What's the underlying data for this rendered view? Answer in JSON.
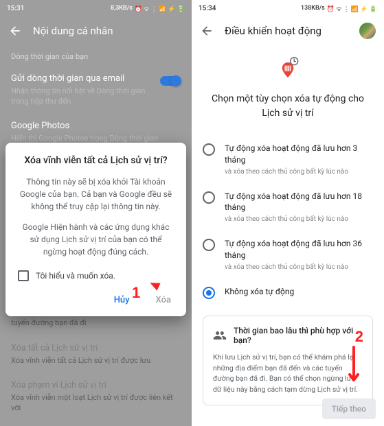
{
  "left": {
    "status": {
      "time": "15:31",
      "net": "8,3KB/s"
    },
    "header": {
      "title": "Nội dung cá nhân"
    },
    "timeline_label": "Dòng thời gian của bạn",
    "email": {
      "title": "Gửi dòng thời gian qua email",
      "sub": "Nhận thông tin nổi bật về Dòng thời gian trong hộp thư đến"
    },
    "photos": {
      "title": "Google Photos",
      "sub": "Hiển thị Google Photos trong Dòng thời gian"
    },
    "dialog": {
      "title": "Xóa vĩnh viễn tất cả Lịch sử vị trí?",
      "body1": "Thông tin này sẽ bị xóa khỏi Tài khoản Google của bạn. Cả bạn và Google đều sẽ không thể truy cập lại thông tin này.",
      "body2": "Google Hiện hành và các ứng dụng khác sử dụng Lịch sử vị trí của bạn có thể ngừng hoạt động đúng cách.",
      "check": "Tôi hiểu và muốn xóa.",
      "cancel": "Hủy",
      "confirm": "Xóa"
    },
    "bg1": {
      "title": "Khám phá lại các địa điểm bạn đã đến và các tuyến đường bạn đã đi"
    },
    "bg2": {
      "title": "Xóa tất cả Lịch sử vị trí",
      "sub": "Xóa vĩnh viễn tất cả Lịch sử vị trí được lưu"
    },
    "bg3": {
      "title": "Xóa phạm vi Lịch sử vị trí",
      "sub": "Xóa vĩnh viễn một loạt Lịch sử vị trí được liên kết với"
    },
    "marker1": "1"
  },
  "right": {
    "status": {
      "time": "15:34",
      "net": "138KB/s"
    },
    "header": {
      "title": "Điều khiển hoạt động"
    },
    "hero": "Chọn một tùy chọn xóa tự động cho Lịch sử vị trí",
    "options": [
      {
        "title": "Tự động xóa hoạt động đã lưu hơn 3 tháng",
        "sub": "và xóa theo cách thủ công bất kỳ lúc nào",
        "checked": false
      },
      {
        "title": "Tự động xóa hoạt động đã lưu hơn 18 tháng",
        "sub": "và xóa theo cách thủ công bất kỳ lúc nào",
        "checked": false
      },
      {
        "title": "Tự động xóa hoạt động đã lưu hơn 36 tháng",
        "sub": "và xóa theo cách thủ công bất kỳ lúc nào",
        "checked": false
      },
      {
        "title": "Không xóa tự động",
        "sub": "",
        "checked": true
      }
    ],
    "info": {
      "title": "Thời gian bao lâu thì phù hợp với bạn?",
      "body": "Khi lưu Lịch sử vị trí, bạn có thể khám phá lại những địa điểm bạn đã đến và các tuyến đường bạn đã đi. Bạn có thể chọn ngừng lưu dữ liệu này bằng cách tạm dừng Lịch sử vị trí."
    },
    "next": "Tiếp theo",
    "marker2": "2"
  }
}
